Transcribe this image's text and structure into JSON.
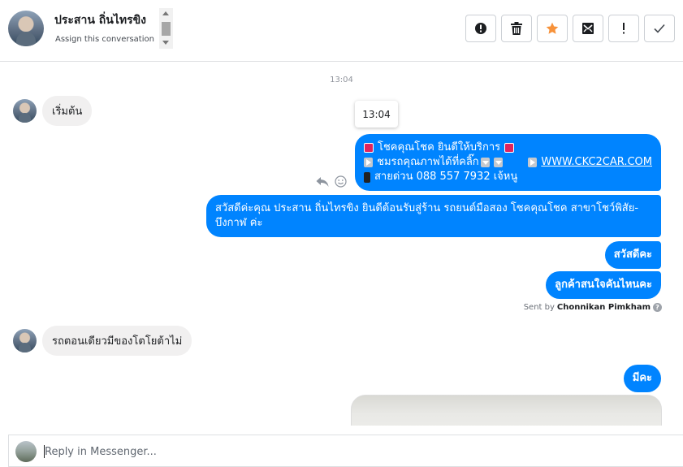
{
  "header": {
    "contact_name": "ประสาน ถิ่นไทรขิง",
    "assign_label": "Assign this conversation",
    "actions": [
      {
        "icon": "alert-circle-icon",
        "glyph": "!"
      },
      {
        "icon": "trash-icon",
        "glyph": ""
      },
      {
        "icon": "star-icon",
        "glyph": ""
      },
      {
        "icon": "mark-unread-icon",
        "glyph": ""
      },
      {
        "icon": "exclamation-icon",
        "glyph": "!"
      },
      {
        "icon": "checkmark-icon",
        "glyph": "✓"
      }
    ],
    "star_color": "#f7923a"
  },
  "conversation": {
    "timestamp": "13:04",
    "tooltip_time": "13:04",
    "messages": {
      "in_1": "เริ่มต้น",
      "out_1": {
        "line1": "โชคคุณโชค ยินดีให้บริการ",
        "line2_prefix": "ชมรถคุณภาพได้ที่คลิ๊ก",
        "line2_link": "WWW.CKC2CAR.COM",
        "line3": "สายด่วน 088 557 7932 เจ้หนู"
      },
      "out_2": "สวัสดีค่ะคุณ ประสาน ถิ่นไทรขิง ยินดีต้อนรับสู่ร้าน รถยนต์มือสอง โชคคุณโชค สาขาโชว์พิสัย-บึงกาฬ ค่ะ",
      "out_3": "สวัสดีคะ",
      "out_4": "ลูกค้าสนใจคันไหนคะ",
      "in_2": "รถตอนเดียวมีของโตโยต้าไม่",
      "out_5": "มีคะ"
    },
    "sent_by_label": "Sent by",
    "sent_by_name": "Chonnikan Pimkham",
    "help_glyph": "?",
    "bubble_color": "#0084ff"
  },
  "reply": {
    "placeholder": "Reply in Messenger..."
  }
}
